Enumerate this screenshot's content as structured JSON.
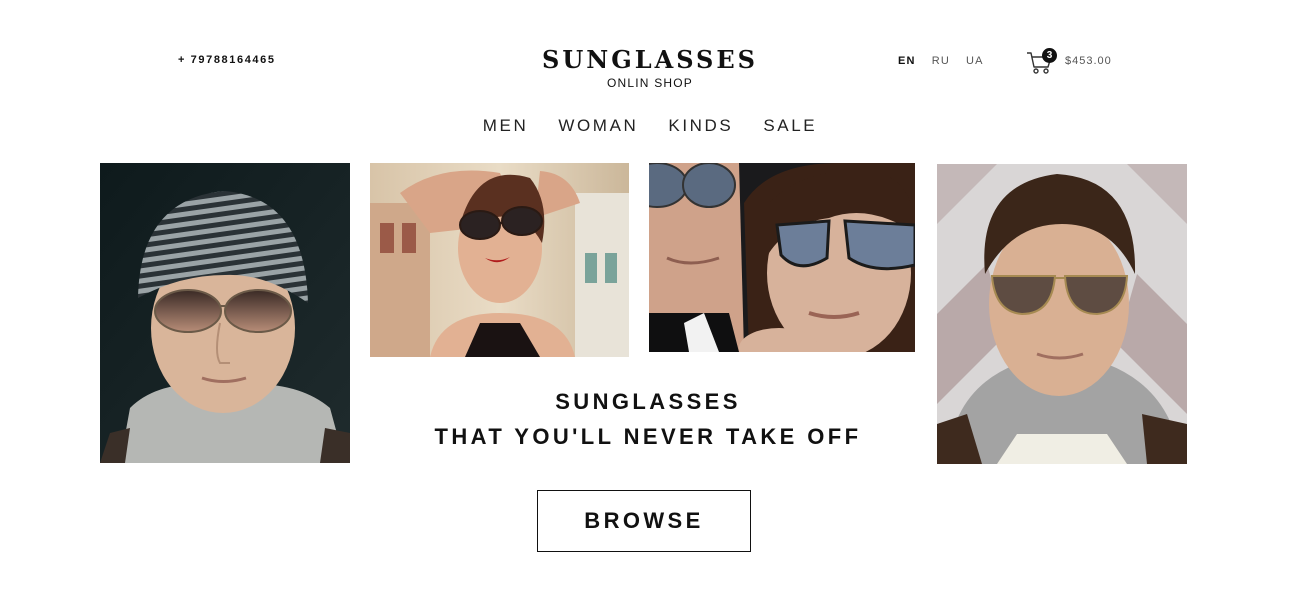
{
  "header": {
    "phone": "+ 79788164465",
    "logo_title": "SUNGLASSES",
    "logo_subtitle": "ONLIN SHOP",
    "languages": [
      {
        "code": "EN",
        "active": true
      },
      {
        "code": "RU",
        "active": false
      },
      {
        "code": "UA",
        "active": false
      }
    ],
    "cart": {
      "count": "3",
      "total": "$453.00",
      "icon": "shopping-cart-icon"
    }
  },
  "nav": {
    "items": [
      "MEN",
      "WOMAN",
      "KINDS",
      "SALE"
    ]
  },
  "hero": {
    "tagline_line1": "SUNGLASSES",
    "tagline_line2": "THAT YOU'LL NEVER TAKE OFF",
    "browse_label": "BROWSE"
  },
  "colors": {
    "text": "#111111",
    "muted": "#555555",
    "background": "#ffffff"
  }
}
